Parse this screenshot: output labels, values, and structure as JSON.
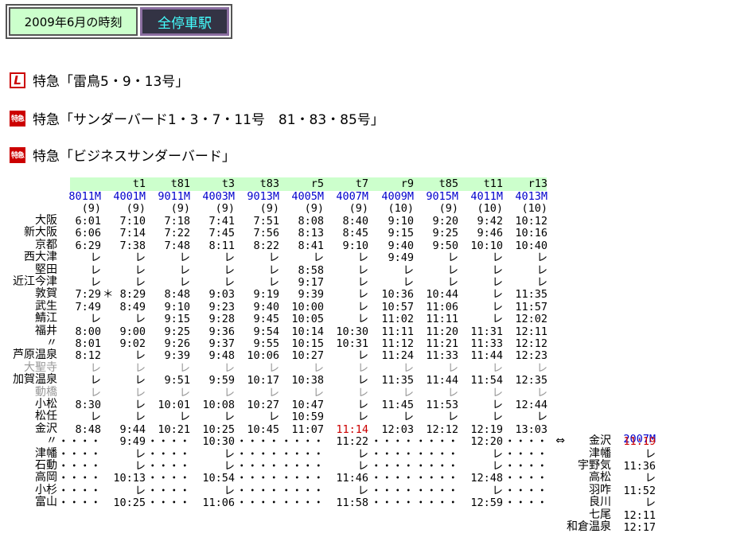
{
  "header": {
    "date_label": "2009年6月の時刻",
    "mode_button": "全停車駅"
  },
  "trains": [
    {
      "icon": "L",
      "name": "特急「雷鳥5・9・13号」"
    },
    {
      "icon": "特急",
      "name": "特急「サンダーバード1・3・7・11号　81・83・85号」"
    },
    {
      "icon": "特急",
      "name": "特急「ビジネスサンダーバード」"
    }
  ],
  "colors": {
    "blue": "#0000cc",
    "red": "#cc0000",
    "gray": "#999999"
  },
  "timetable": {
    "codes": [
      "",
      "t1",
      "t81",
      "t3",
      "t83",
      "r5",
      "t7",
      "r9",
      "t85",
      "t11",
      "r13"
    ],
    "numbers": [
      "8011M",
      "4001M",
      "9011M",
      "4003M",
      "9013M",
      "4005M",
      "4007M",
      "4009M",
      "9015M",
      "4011M",
      "4013M"
    ],
    "cars": [
      "(9)",
      "(9)",
      "(9)",
      "(9)",
      "(9)",
      "(9)",
      "(9)",
      "(10)",
      "(9)",
      "(10)",
      "(10)"
    ],
    "stations": [
      "大阪",
      "新大阪",
      "京都",
      "西大津",
      "堅田",
      "近江今津",
      "敦賀",
      "武生",
      "鯖江",
      "福井",
      "〃",
      "芦原温泉",
      "大聖寺",
      "加賀温泉",
      "動橋",
      "小松",
      "松任",
      "金沢",
      "〃",
      "津幡",
      "石動",
      "高岡",
      "小杉",
      "富山"
    ],
    "gray_rows": [
      12,
      14
    ],
    "rows": [
      [
        "6:01",
        "7:10",
        "7:18",
        "7:41",
        "7:51",
        "8:08",
        "8:40",
        "9:10",
        "9:20",
        "9:42",
        "10:12"
      ],
      [
        "6:06",
        "7:14",
        "7:22",
        "7:45",
        "7:56",
        "8:13",
        "8:45",
        "9:15",
        "9:25",
        "9:46",
        "10:16"
      ],
      [
        "6:29",
        "7:38",
        "7:48",
        "8:11",
        "8:22",
        "8:41",
        "9:10",
        "9:40",
        "9:50",
        "10:10",
        "10:40"
      ],
      [
        "レ",
        "レ",
        "レ",
        "レ",
        "レ",
        "レ",
        "レ",
        "9:49",
        "レ",
        "レ",
        "レ"
      ],
      [
        "レ",
        "レ",
        "レ",
        "レ",
        "レ",
        "8:58",
        "レ",
        "レ",
        "レ",
        "レ",
        "レ"
      ],
      [
        "レ",
        "レ",
        "レ",
        "レ",
        "レ",
        "9:17",
        "レ",
        "レ",
        "レ",
        "レ",
        "レ"
      ],
      [
        "7:29",
        "＊ 8:29",
        "8:48",
        "9:03",
        "9:19",
        "9:39",
        "レ",
        "10:36",
        "10:44",
        "レ",
        "11:35"
      ],
      [
        "7:49",
        "8:49",
        "9:10",
        "9:23",
        "9:40",
        "10:00",
        "レ",
        "10:57",
        "11:06",
        "レ",
        "11:57"
      ],
      [
        "レ",
        "レ",
        "9:15",
        "9:28",
        "9:45",
        "10:05",
        "レ",
        "11:02",
        "11:11",
        "レ",
        "12:02"
      ],
      [
        "8:00",
        "9:00",
        "9:25",
        "9:36",
        "9:54",
        "10:14",
        "10:30",
        "11:11",
        "11:20",
        "11:31",
        "12:11"
      ],
      [
        "8:01",
        "9:02",
        "9:26",
        "9:37",
        "9:55",
        "10:15",
        "10:31",
        "11:12",
        "11:21",
        "11:33",
        "12:12"
      ],
      [
        "8:12",
        "レ",
        "9:39",
        "9:48",
        "10:06",
        "10:27",
        "レ",
        "11:24",
        "11:33",
        "11:44",
        "12:23"
      ],
      [
        "レ",
        "レ",
        "レ",
        "レ",
        "レ",
        "レ",
        "レ",
        "レ",
        "レ",
        "レ",
        "レ"
      ],
      [
        "レ",
        "レ",
        "9:51",
        "9:59",
        "10:17",
        "10:38",
        "レ",
        "11:35",
        "11:44",
        "11:54",
        "12:35"
      ],
      [
        "レ",
        "レ",
        "レ",
        "レ",
        "レ",
        "レ",
        "レ",
        "レ",
        "レ",
        "レ",
        "レ"
      ],
      [
        "8:30",
        "レ",
        "10:01",
        "10:08",
        "10:27",
        "10:47",
        "レ",
        "11:45",
        "11:53",
        "レ",
        "12:44"
      ],
      [
        "レ",
        "レ",
        "レ",
        "レ",
        "レ",
        "10:59",
        "レ",
        "レ",
        "レ",
        "レ",
        "レ"
      ],
      [
        "8:48",
        "9:44",
        "10:21",
        "10:25",
        "10:45",
        "11:07",
        "11:14",
        "12:03",
        "12:12",
        "12:19",
        "13:03"
      ],
      [
        "・・・・",
        "9:49",
        "・・・・",
        "10:30",
        "・・・・",
        "・・・・",
        "11:22",
        "・・・・",
        "・・・・",
        "12:20",
        "・・・・"
      ],
      [
        "・・・・",
        "レ",
        "・・・・",
        "レ",
        "・・・・",
        "・・・・",
        "レ",
        "・・・・",
        "・・・・",
        "レ",
        "・・・・"
      ],
      [
        "・・・・",
        "レ",
        "・・・・",
        "レ",
        "・・・・",
        "・・・・",
        "レ",
        "・・・・",
        "・・・・",
        "レ",
        "・・・・"
      ],
      [
        "・・・・",
        "10:13",
        "・・・・",
        "10:54",
        "・・・・",
        "・・・・",
        "11:46",
        "・・・・",
        "・・・・",
        "12:48",
        "・・・・"
      ],
      [
        "・・・・",
        "レ",
        "・・・・",
        "レ",
        "・・・・",
        "・・・・",
        "レ",
        "・・・・",
        "・・・・",
        "レ",
        "・・・・"
      ],
      [
        "・・・・",
        "10:25",
        "・・・・",
        "11:06",
        "・・・・",
        "・・・・",
        "11:58",
        "・・・・",
        "・・・・",
        "12:59",
        "・・・・"
      ]
    ],
    "red_cells": [
      [
        17,
        6
      ]
    ]
  },
  "connection": {
    "arrow": "⇔",
    "number": "2007M",
    "stations": [
      "金沢",
      "津幡",
      "宇野気",
      "高松",
      "羽咋",
      "良川",
      "七尾",
      "和倉温泉"
    ],
    "times": [
      "11:19",
      "レ",
      "11:36",
      "レ",
      "11:52",
      "レ",
      "12:11",
      "12:17"
    ]
  }
}
